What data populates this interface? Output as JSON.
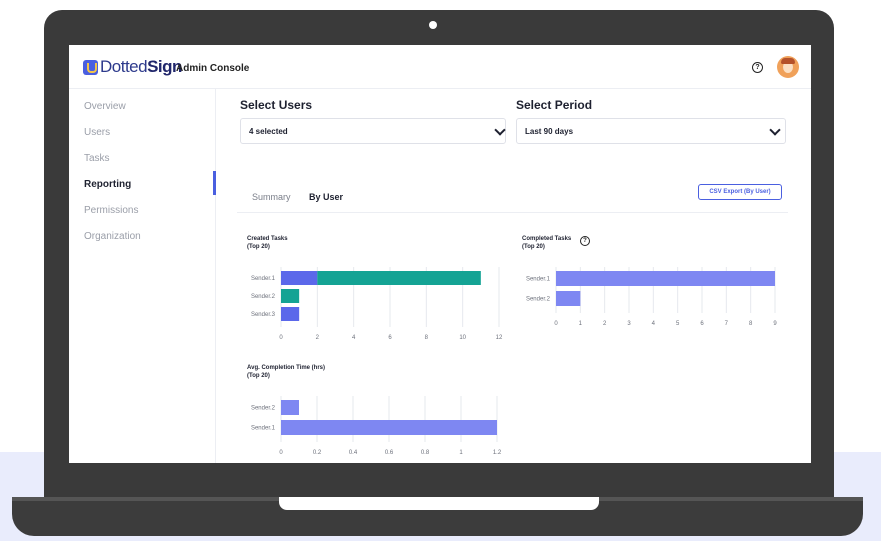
{
  "app": {
    "brand_light": "Dotted",
    "brand_bold": "Sign",
    "console_title": "Admin Console"
  },
  "header": {
    "help_icon": "question-circle-icon",
    "avatar": "user-avatar"
  },
  "sidebar": {
    "items": [
      {
        "label": "Overview"
      },
      {
        "label": "Users"
      },
      {
        "label": "Tasks"
      },
      {
        "label": "Reporting",
        "active": true
      },
      {
        "label": "Permissions"
      },
      {
        "label": "Organization"
      }
    ]
  },
  "filters": {
    "users_label": "Select Users",
    "users_value": "4 selected",
    "period_label": "Select Period",
    "period_value": "Last 90 days"
  },
  "tabs": [
    {
      "label": "Summary",
      "active": false
    },
    {
      "label": "By User",
      "active": true
    }
  ],
  "export_button": "CSV Export (By User)",
  "colors": {
    "accent": "#4a5fe0",
    "bar_blue": "#5b68ea",
    "bar_light": "#7e87f2",
    "bar_teal": "#14a394"
  },
  "chart_data": [
    {
      "id": "created",
      "type": "bar",
      "orientation": "horizontal",
      "stacked": true,
      "title": "Created Tasks\n(Top 20)",
      "categories": [
        "Sender.1",
        "Sender.2",
        "Sender.3"
      ],
      "series": [
        {
          "values": [
            2,
            0,
            1
          ],
          "color": "#5b68ea"
        },
        {
          "values": [
            9,
            1,
            0
          ],
          "color": "#14a394"
        }
      ],
      "xlim": [
        0,
        12
      ],
      "ticks": [
        0,
        2,
        4,
        6,
        8,
        10,
        12
      ],
      "tick_labels": [
        "0",
        "2",
        "4",
        "6",
        "8",
        "10",
        "12"
      ]
    },
    {
      "id": "completed",
      "type": "bar",
      "orientation": "horizontal",
      "title": "Completed Tasks\n(Top 20)",
      "categories": [
        "Sender.1",
        "Sender.2"
      ],
      "series": [
        {
          "values": [
            9,
            1
          ],
          "color": "#7e87f2"
        }
      ],
      "xlim": [
        0,
        9
      ],
      "ticks": [
        0,
        1,
        2,
        3,
        4,
        5,
        6,
        7,
        8,
        9
      ],
      "tick_labels": [
        "0",
        "1",
        "2",
        "3",
        "4",
        "5",
        "6",
        "7",
        "8",
        "9"
      ]
    },
    {
      "id": "avgtime",
      "type": "bar",
      "orientation": "horizontal",
      "title": "Avg. Completion Time (hrs)\n(Top 20)",
      "categories": [
        "Sender.2",
        "Sender.1"
      ],
      "series": [
        {
          "values": [
            0.1,
            1.2
          ],
          "color": "#7e87f2"
        }
      ],
      "xlim": [
        0,
        1.2
      ],
      "ticks": [
        0,
        0.2,
        0.4,
        0.6,
        0.8,
        1,
        1.2
      ],
      "tick_labels": [
        "0",
        "0.2",
        "0.4",
        "0.6",
        "0.8",
        "1",
        "1.2"
      ]
    }
  ]
}
